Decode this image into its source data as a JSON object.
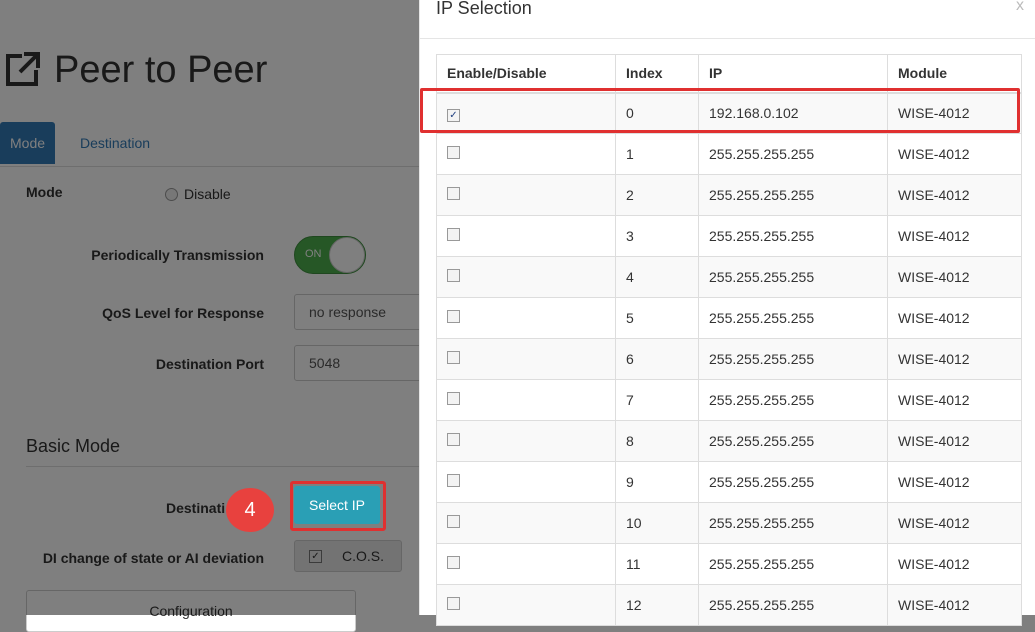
{
  "page": {
    "title": "Peer to Peer",
    "tabs": [
      "Mode",
      "Destination"
    ],
    "mode_label": "Mode",
    "mode_option": "Disable",
    "periodic_label": "Periodically Transmission",
    "periodic_toggle": "ON",
    "qos_label": "QoS Level for Response",
    "qos_value": "no response",
    "dest_port_label": "Destination Port",
    "dest_port_value": "5048",
    "section_title": "Basic Mode",
    "destination_label": "Destinati",
    "select_ip_label": "Select IP",
    "step_number": "4",
    "di_label": "DI change of state or AI deviation",
    "cos_label": "C.O.S.",
    "config_label": "Configuration"
  },
  "modal": {
    "title": "IP Selection",
    "close": "x",
    "columns": [
      "Enable/Disable",
      "Index",
      "IP",
      "Module"
    ],
    "rows": [
      {
        "checked": true,
        "index": "0",
        "ip": "192.168.0.102",
        "module": "WISE-4012"
      },
      {
        "checked": false,
        "index": "1",
        "ip": "255.255.255.255",
        "module": "WISE-4012"
      },
      {
        "checked": false,
        "index": "2",
        "ip": "255.255.255.255",
        "module": "WISE-4012"
      },
      {
        "checked": false,
        "index": "3",
        "ip": "255.255.255.255",
        "module": "WISE-4012"
      },
      {
        "checked": false,
        "index": "4",
        "ip": "255.255.255.255",
        "module": "WISE-4012"
      },
      {
        "checked": false,
        "index": "5",
        "ip": "255.255.255.255",
        "module": "WISE-4012"
      },
      {
        "checked": false,
        "index": "6",
        "ip": "255.255.255.255",
        "module": "WISE-4012"
      },
      {
        "checked": false,
        "index": "7",
        "ip": "255.255.255.255",
        "module": "WISE-4012"
      },
      {
        "checked": false,
        "index": "8",
        "ip": "255.255.255.255",
        "module": "WISE-4012"
      },
      {
        "checked": false,
        "index": "9",
        "ip": "255.255.255.255",
        "module": "WISE-4012"
      },
      {
        "checked": false,
        "index": "10",
        "ip": "255.255.255.255",
        "module": "WISE-4012"
      },
      {
        "checked": false,
        "index": "11",
        "ip": "255.255.255.255",
        "module": "WISE-4012"
      },
      {
        "checked": false,
        "index": "12",
        "ip": "255.255.255.255",
        "module": "WISE-4012"
      }
    ]
  },
  "colors": {
    "primary": "#337ab7",
    "toggle_on": "#4cae4c",
    "select_button": "#2a9fb5",
    "highlight": "#e03030"
  }
}
